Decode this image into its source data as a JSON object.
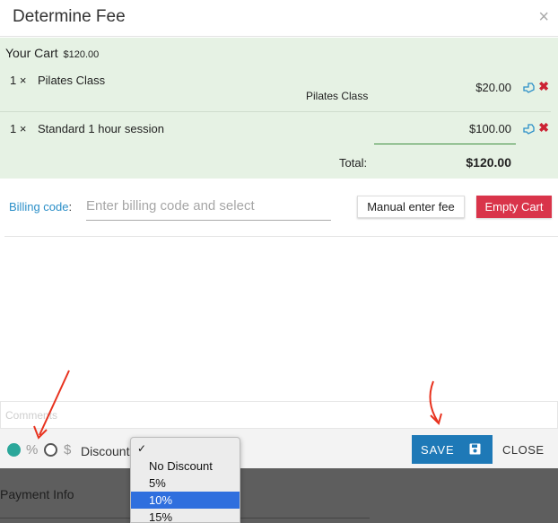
{
  "modal": {
    "title": "Determine Fee",
    "close_glyph": "×"
  },
  "cart": {
    "heading": "Your Cart",
    "heading_total": "$120.00",
    "items": [
      {
        "qty": "1 ×",
        "name": "Pilates Class",
        "sub": "Pilates Class",
        "price": "$20.00"
      },
      {
        "qty": "1 ×",
        "name": "Standard 1 hour session",
        "sub": "",
        "price": "$100.00"
      }
    ],
    "total_label": "Total:",
    "total_value": "$120.00"
  },
  "billing": {
    "label": "Billing code",
    "colon": ":",
    "placeholder": "Enter billing code and select",
    "manual_button": "Manual enter fee",
    "empty_button": "Empty Cart"
  },
  "comments": {
    "placeholder": "Comments"
  },
  "footer": {
    "percent_symbol": "%",
    "dollar_symbol": "$",
    "discount_label": "Discount",
    "save_label": "SAVE",
    "close_label": "CLOSE"
  },
  "discount_dropdown": {
    "checkmark": "✓",
    "options": [
      "No Discount",
      "5%",
      "10%",
      "15%"
    ],
    "selected": "10%"
  },
  "background": {
    "payment_info": "Payment Info"
  },
  "colors": {
    "cart_bg": "#e6f2e4",
    "accent_blue": "#1e79b7",
    "danger": "#d9344a",
    "radio_teal": "#2ba79a",
    "annotation_red": "#e8321e"
  },
  "icons": [
    "close-icon",
    "edit-icon",
    "delete-icon",
    "floppy-disk-icon",
    "checkmark-icon"
  ]
}
